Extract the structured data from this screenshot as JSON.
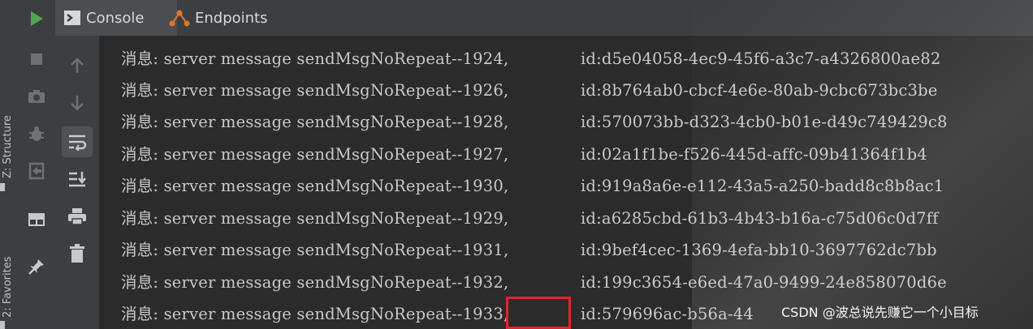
{
  "side_tabs": {
    "structure_label": "Z: Structure",
    "favorites_label": "2: Favorites"
  },
  "tabs": [
    {
      "label": "Console",
      "icon": "console-icon",
      "active": true
    },
    {
      "label": "Endpoints",
      "icon": "endpoints-icon",
      "active": false
    }
  ],
  "toolbar_icons": [
    "up-arrow-icon",
    "down-arrow-icon",
    "soft-wrap-icon",
    "scroll-to-end-icon",
    "print-icon",
    "trash-icon"
  ],
  "run_icons": [
    "run-icon",
    "stop-icon",
    "camera-icon",
    "debug-icon",
    "exit-icon",
    "layout-icon",
    "pin-icon"
  ],
  "console": {
    "lines": [
      {
        "text": "消息: server message sendMsgNoRepeat--1924,",
        "id": "id:d5e04058-4ec9-45f6-a3c7-a4326800ae82"
      },
      {
        "text": "消息: server message sendMsgNoRepeat--1926,",
        "id": "id:8b764ab0-cbcf-4e6e-80ab-9cbc673bc3be"
      },
      {
        "text": "消息: server message sendMsgNoRepeat--1928,",
        "id": "id:570073bb-d323-4cb0-b01e-d49c749429c8"
      },
      {
        "text": "消息: server message sendMsgNoRepeat--1927,",
        "id": "id:02a1f1be-f526-445d-affc-09b41364f1b4"
      },
      {
        "text": "消息: server message sendMsgNoRepeat--1930,",
        "id": "id:919a8a6e-e112-43a5-a250-badd8c8b8ac1"
      },
      {
        "text": "消息: server message sendMsgNoRepeat--1929,",
        "id": "id:a6285cbd-61b3-4b43-b16a-c75d06c0d7ff"
      },
      {
        "text": "消息: server message sendMsgNoRepeat--1931,",
        "id": "id:9bef4cec-1369-4efa-bb10-3697762dc7bb"
      },
      {
        "text": "消息: server message sendMsgNoRepeat--1932,",
        "id": "id:199c3654-e6ed-47a0-9499-24e858070d6e"
      },
      {
        "text": "消息: server message sendMsgNoRepeat--1933,",
        "id": "id:579696ac-b56a-44"
      }
    ]
  },
  "watermark": "CSDN @波总说先赚它一个小目标",
  "colors": {
    "highlight": "#e3232a",
    "run_green": "#4fa84f",
    "endpoints_orange": "#e0772b"
  }
}
